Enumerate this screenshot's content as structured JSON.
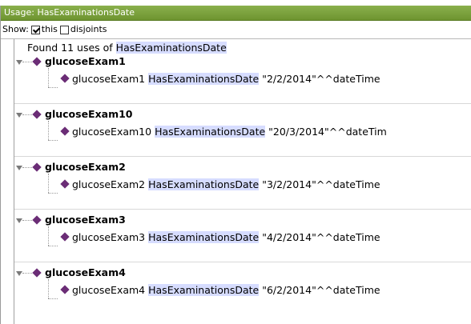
{
  "panel": {
    "title": "Usage: HasExaminationsDate",
    "show_label": "Show:",
    "this_label": "this",
    "disjoints_label": "disjoints",
    "found_prefix": "Found 11 uses of",
    "found_term": "HasExaminationsDate"
  },
  "groups": [
    {
      "name": "glucoseExam1",
      "subject": "glucoseExam1",
      "property": "HasExaminationsDate",
      "value": "\"2/2/2014\"^^dateTime"
    },
    {
      "name": "glucoseExam10",
      "subject": "glucoseExam10",
      "property": "HasExaminationsDate",
      "value": "\"20/3/2014\"^^dateTim"
    },
    {
      "name": "glucoseExam2",
      "subject": "glucoseExam2",
      "property": "HasExaminationsDate",
      "value": "\"3/2/2014\"^^dateTime"
    },
    {
      "name": "glucoseExam3",
      "subject": "glucoseExam3",
      "property": "HasExaminationsDate",
      "value": "\"4/2/2014\"^^dateTime"
    },
    {
      "name": "glucoseExam4",
      "subject": "glucoseExam4",
      "property": "HasExaminationsDate",
      "value": "\"6/2/2014\"^^dateTime"
    }
  ],
  "colors": {
    "titlebar": "#7aa33a",
    "individual_diamond": "#6b2d76",
    "highlight": "#d6dcff"
  }
}
